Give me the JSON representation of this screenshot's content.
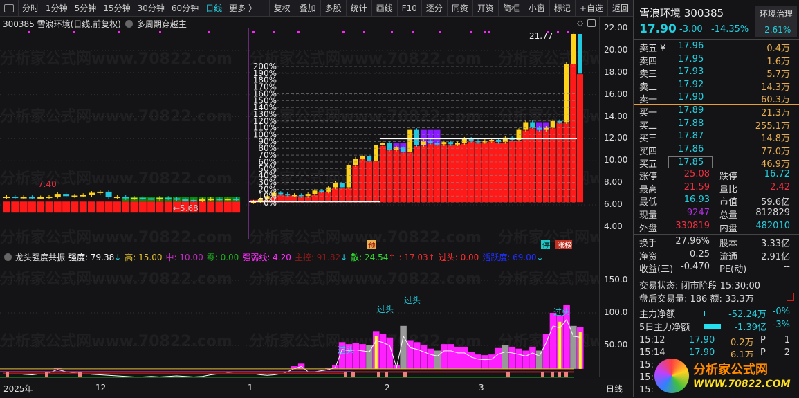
{
  "toolbar": {
    "periods": [
      "分时",
      "1分钟",
      "5分钟",
      "15分钟",
      "30分钟",
      "60分钟",
      "日线",
      "更多 〉"
    ],
    "active": "日线",
    "buttons": [
      "复权",
      "叠加",
      "多股",
      "统计",
      "画线",
      "F10",
      "逐分",
      "同资",
      "开资",
      "简框",
      "小窗",
      "标记",
      "+自选",
      "返回"
    ]
  },
  "title": {
    "stock": "300385 雪浪环境(日线,前复权)",
    "indicator": "多周期穿越主"
  },
  "watermark": "分析家公式网www.70822.com",
  "price_axis": [
    "22.00",
    "20.00",
    "18.00",
    "16.00",
    "14.00",
    "12.00",
    "10.00",
    "8.00",
    "6.00",
    "4.00"
  ],
  "price_axis_values": [
    22,
    20,
    18,
    16,
    14,
    12,
    10,
    8,
    6,
    4
  ],
  "annotations": {
    "high": "21.77",
    "left_high": "7.40",
    "low": "5.68",
    "pre": "预",
    "halt": "停",
    "rank": "涨榜"
  },
  "percent_labels": [
    "0%",
    "10%",
    "20%",
    "30%",
    "40%",
    "50%",
    "60%",
    "70%",
    "80%",
    "90%",
    "100%",
    "110%",
    "120%",
    "130%",
    "140%",
    "150%",
    "160%",
    "170%",
    "180%",
    "190%",
    "200%"
  ],
  "candles_left": [
    6.75,
    6.7,
    6.72,
    6.68,
    6.7,
    6.75,
    7.0,
    6.8,
    6.85,
    6.9,
    7.1,
    7.2,
    6.7,
    6.75,
    6.6,
    6.65,
    6.6,
    6.55,
    6.65,
    6.6,
    6.5,
    6.45,
    6.4,
    6.5,
    6.55,
    6.5,
    6.55,
    6.5
  ],
  "candles_right": [
    6.3,
    6.5,
    6.8,
    7.1,
    7.0,
    6.9,
    6.9,
    6.8,
    7.0,
    7.3,
    7.2,
    7.6,
    8.0,
    7.6,
    9.6,
    10.2,
    10.4,
    10.0,
    11.4,
    11.6,
    11.0,
    11.2,
    10.8,
    12.8,
    11.4,
    11.8,
    11.6,
    11.5,
    11.7,
    11.5,
    11.6,
    12.0,
    11.8,
    11.7,
    11.8,
    11.9,
    11.7,
    12.1,
    11.9,
    12.8,
    13.5,
    13.0,
    12.8,
    13.0,
    13.6,
    13.5,
    18.8,
    21.5,
    17.9
  ],
  "strength_left": [
    8,
    9,
    7,
    6,
    8,
    10,
    16,
    12,
    10,
    9,
    7,
    6,
    5,
    4,
    3,
    2,
    2,
    3,
    2,
    3,
    4,
    3,
    2,
    3,
    6,
    8,
    10,
    9
  ],
  "strength_right": [
    8,
    6,
    5,
    6,
    8,
    12,
    18,
    22,
    12,
    12,
    14,
    16,
    20,
    55,
    52,
    54,
    52,
    50,
    72,
    68,
    62,
    20,
    80,
    58,
    55,
    50,
    45,
    42,
    52,
    52,
    48,
    48,
    40,
    36,
    35,
    36,
    46,
    50,
    48,
    45,
    42,
    48,
    42,
    68,
    100,
    96,
    112,
    80,
    78
  ],
  "indicator": {
    "name": "龙头强度共振",
    "items": [
      {
        "label": "强度: 79.38",
        "color": "#ffffff",
        "arrow": "↓"
      },
      {
        "label": "高: 15.00",
        "color": "#e0c030"
      },
      {
        "label": "中: 10.00",
        "color": "#c030c0"
      },
      {
        "label": "零: 0.00",
        "color": "#20b020"
      },
      {
        "label": "强弱线: 4.20",
        "color": "#ff30ff"
      },
      {
        "label": "主控: 91.82",
        "color": "#8a1a1a",
        "arrow": "↓"
      },
      {
        "label": "散: 24.54",
        "color": "#30e030",
        "arrow": "↑"
      },
      {
        "label": ": 17.03",
        "color": "#e03030",
        "arrow": "↑"
      },
      {
        "label": "过头: 0.00",
        "color": "#ff3030"
      },
      {
        "label": "活跃度: 69.00",
        "color": "#2030ff",
        "arrow": "↓"
      }
    ]
  },
  "lower_axis": [
    "150.0",
    "100.0",
    "50.00"
  ],
  "lower_axis_values": [
    150,
    100,
    50
  ],
  "lower_labels": [
    "过头",
    "过头",
    "过头",
    "过头"
  ],
  "time_axis": [
    "2025年",
    "12",
    "1",
    "2",
    "3",
    "日线"
  ],
  "quote": {
    "name": "雪浪环境 300385",
    "sector": "环境治理",
    "sector_change": "-2.61%",
    "price": "17.90",
    "change": "-3.00",
    "pct": "-14.35%"
  },
  "asks": [
    {
      "label": "卖五 ¥",
      "price": "17.96",
      "vol": "0.4万"
    },
    {
      "label": "卖四",
      "price": "17.95",
      "vol": "1.6万"
    },
    {
      "label": "卖三",
      "price": "17.93",
      "vol": "5.7万"
    },
    {
      "label": "卖二",
      "price": "17.92",
      "vol": "14.3万"
    },
    {
      "label": "卖一",
      "price": "17.90",
      "vol": "60.3万"
    }
  ],
  "bids": [
    {
      "label": "买一",
      "price": "17.89",
      "vol": "21.3万"
    },
    {
      "label": "买二",
      "price": "17.88",
      "vol": "255.1万"
    },
    {
      "label": "买三",
      "price": "17.87",
      "vol": "14.8万"
    },
    {
      "label": "买四",
      "price": "17.86",
      "vol": "77.0万"
    },
    {
      "label": "买五",
      "price": "17.85",
      "vol": "46.9万"
    }
  ],
  "stats": [
    {
      "l1": "涨停",
      "v1": "25.08",
      "c1": "#f03040",
      "l2": "跌停",
      "v2": "16.72",
      "c2": "#22d0e0"
    },
    {
      "l1": "最高",
      "v1": "21.59",
      "c1": "#f03040",
      "l2": "量比",
      "v2": "2.42",
      "c2": "#f03040"
    },
    {
      "l1": "最低",
      "v1": "16.93",
      "c1": "#22d0e0",
      "l2": "市值",
      "v2": "59.6亿",
      "c2": "#d8d8d8"
    },
    {
      "l1": "现量",
      "v1": "9247",
      "c1": "#b030e0",
      "l2": "总量",
      "v2": "812829",
      "c2": "#d8d8d8"
    },
    {
      "l1": "外盘",
      "v1": "330819",
      "c1": "#f03040",
      "l2": "内盘",
      "v2": "482010",
      "c2": "#22d0e0"
    }
  ],
  "stats2": [
    {
      "l1": "换手",
      "v1": "27.96%",
      "l2": "股本",
      "v2": "3.33亿"
    },
    {
      "l1": "净资",
      "v1": "0.25",
      "l2": "流通",
      "v2": "2.91亿"
    },
    {
      "l1": "收益(三)",
      "v1": "-0.470",
      "l2": "PE(动)",
      "v2": "--"
    }
  ],
  "trade_status": "交易状态: 闭市阶段 15:30:00",
  "after_hours": "盘后交易量: 186  额: 33.3万",
  "flows": [
    {
      "label": "主力净额",
      "value": "-52.24万",
      "pct": "-0%",
      "bar": 0.02
    },
    {
      "label": "5日主力净额",
      "value": "-1.39亿",
      "pct": "-3%",
      "bar": 0.6
    }
  ],
  "ticks": [
    {
      "time": "15:12",
      "price": "17.90",
      "vol": "0.2万",
      "type": "P",
      "n": "1"
    },
    {
      "time": "15:14",
      "price": "17.90",
      "vol": "6.1万",
      "type": "P",
      "n": "2"
    },
    {
      "time": "15:1",
      "price": "",
      "vol": "",
      "type": "",
      "n": ""
    },
    {
      "time": "15:1",
      "price": "",
      "vol": "",
      "type": "",
      "n": ""
    },
    {
      "time": "15:1",
      "price": "",
      "vol": "",
      "type": "",
      "n": ""
    }
  ],
  "logo": {
    "text": "分析家公式网",
    "url": "WWW.70822.COM"
  },
  "colors": {
    "up": "#ffd21a",
    "down": "#22c8e0",
    "bg_red": "#ff1a1a",
    "bg_purple": "#8a1aff",
    "green": "#0a8a0a",
    "magenta": "#ff20ff",
    "cyan": "#22d0e0",
    "orange": "#e8b050"
  }
}
